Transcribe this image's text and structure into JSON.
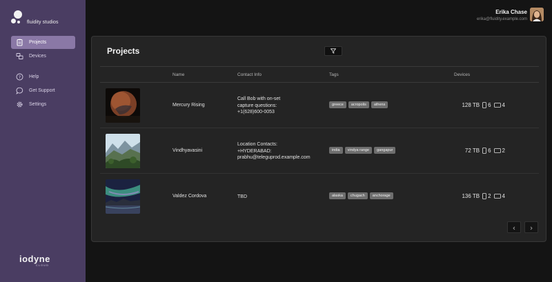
{
  "brand": {
    "name": "fluidity studios"
  },
  "sidebar": {
    "items": [
      {
        "label": "Projects",
        "icon": "clipboard-icon"
      },
      {
        "label": "Devices",
        "icon": "devices-icon"
      },
      {
        "label": "Help",
        "icon": "help-circle-icon"
      },
      {
        "label": "Get Support",
        "icon": "chat-bubble-icon"
      },
      {
        "label": "Settings",
        "icon": "gear-icon"
      }
    ],
    "active": "Projects"
  },
  "footer": {
    "logo_word": "iodyne",
    "logo_sub": "CLOUD"
  },
  "user": {
    "name": "Erika Chase",
    "email": "erika@fluidity.example.com"
  },
  "main": {
    "title": "Projects",
    "columns": {
      "name": "Name",
      "contact": "Contact Info",
      "tags": "Tags",
      "devices": "Devices"
    },
    "rows": [
      {
        "name": "Mercury Rising",
        "contact": [
          "Call Bob with on-set",
          "capture questions:",
          "+1(628)600-0053"
        ],
        "tags": [
          "greece",
          "acropolis",
          "athens"
        ],
        "storage": "128 TB",
        "phones": "6",
        "tablets": "4"
      },
      {
        "name": "Vindhyavasini",
        "contact": [
          "Location Contacts:",
          "+HYDERABAD:",
          "prabhu@teleguprod.example.com"
        ],
        "tags": [
          "india",
          "vindya range",
          "gangapur"
        ],
        "storage": "72 TB",
        "phones": "6",
        "tablets": "2"
      },
      {
        "name": "Valdez Cordova",
        "contact": [
          "TBD"
        ],
        "tags": [
          "alaska",
          "chugach",
          "anchorage"
        ],
        "storage": "136 TB",
        "phones": "2",
        "tablets": "4"
      }
    ]
  },
  "colors": {
    "sidebar": "#4a3d62",
    "active_nav": "#8a78a6",
    "panel": "#242424",
    "tag": "#6e6e6e"
  }
}
